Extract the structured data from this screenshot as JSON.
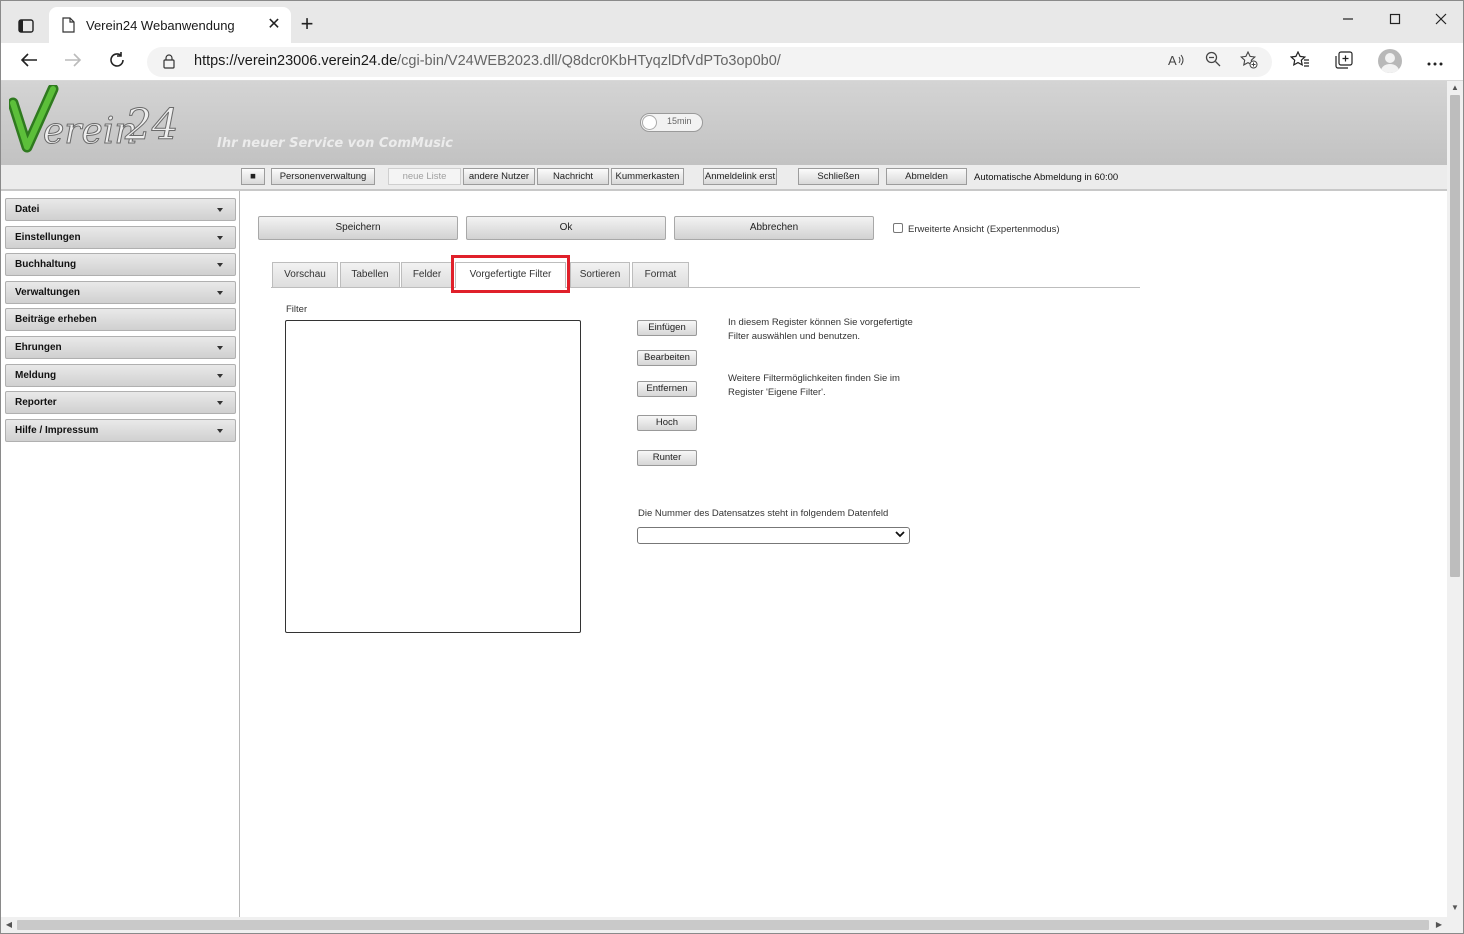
{
  "browser": {
    "tab_title": "Verein24 Webanwendung",
    "tab_close": "✕",
    "new_tab": "+",
    "url_host": "https://verein23006.verein24.de",
    "url_path": "/cgi-bin/V24WEB2023.dll/Q8dcr0KbHTyqzlDfVdPTo3op0b0/",
    "icons": [
      "tabs-icon",
      "page-icon",
      "back-arrow-icon",
      "forward-arrow-icon",
      "reload-icon",
      "lock-icon",
      "read-aloud-icon",
      "zoom-out-icon",
      "add-favorite-icon",
      "favorites-icon",
      "collections-icon",
      "profile-icon",
      "more-menu-icon",
      "minimize-icon",
      "maximize-icon",
      "close-icon"
    ]
  },
  "header": {
    "logo_text": "Verein24",
    "tagline": "Ihr neuer Service von ComMusic",
    "timer_label": "15min"
  },
  "toolbar": {
    "square_label": "■",
    "buttons": [
      "Personenverwaltung",
      "neue Liste",
      "andere Nutzer",
      "Nachricht",
      "Kummerkasten",
      "Anmeldelink erst",
      "Schließen",
      "Abmelden"
    ],
    "auto_logout": "Automatische Abmeldung in 60:00"
  },
  "sidebar": {
    "items": [
      {
        "label": "Datei",
        "has_dropdown": true
      },
      {
        "label": "Einstellungen",
        "has_dropdown": true
      },
      {
        "label": "Buchhaltung",
        "has_dropdown": true
      },
      {
        "label": "Verwaltungen",
        "has_dropdown": true
      },
      {
        "label": "Beiträge erheben",
        "has_dropdown": false
      },
      {
        "label": "Ehrungen",
        "has_dropdown": true
      },
      {
        "label": "Meldung",
        "has_dropdown": true
      },
      {
        "label": "Reporter",
        "has_dropdown": true
      },
      {
        "label": "Hilfe / Impressum",
        "has_dropdown": true
      }
    ]
  },
  "actions": {
    "save": "Speichern",
    "ok": "Ok",
    "cancel": "Abbrechen",
    "expert_mode": "Erweiterte Ansicht (Expertenmodus)",
    "expert_checked": false
  },
  "tabs": [
    {
      "label": "Vorschau",
      "active": false
    },
    {
      "label": "Tabellen",
      "active": false
    },
    {
      "label": "Felder",
      "active": false
    },
    {
      "label": "Vorgefertigte Filter",
      "active": true
    },
    {
      "label": "Sortieren",
      "active": false
    },
    {
      "label": "Format",
      "active": false
    }
  ],
  "filter_panel": {
    "list_label": "Filter",
    "buttons": [
      "Einfügen",
      "Bearbeiten",
      "Entfernen",
      "Hoch",
      "Runter"
    ],
    "help_1": "In diesem Register können Sie vorgefertigte Filter auswählen und benutzen.",
    "help_2": "Weitere Filtermöglichkeiten finden Sie im Register 'Eigene Filter'.",
    "datensatz_label": "Die Nummer des Datensatzes steht in folgendem Datenfeld",
    "datensatz_value": ""
  },
  "colors": {
    "highlight": "#e0202a",
    "logo_green": "#3f9a2a",
    "header_gray": "#c8c8c8"
  }
}
